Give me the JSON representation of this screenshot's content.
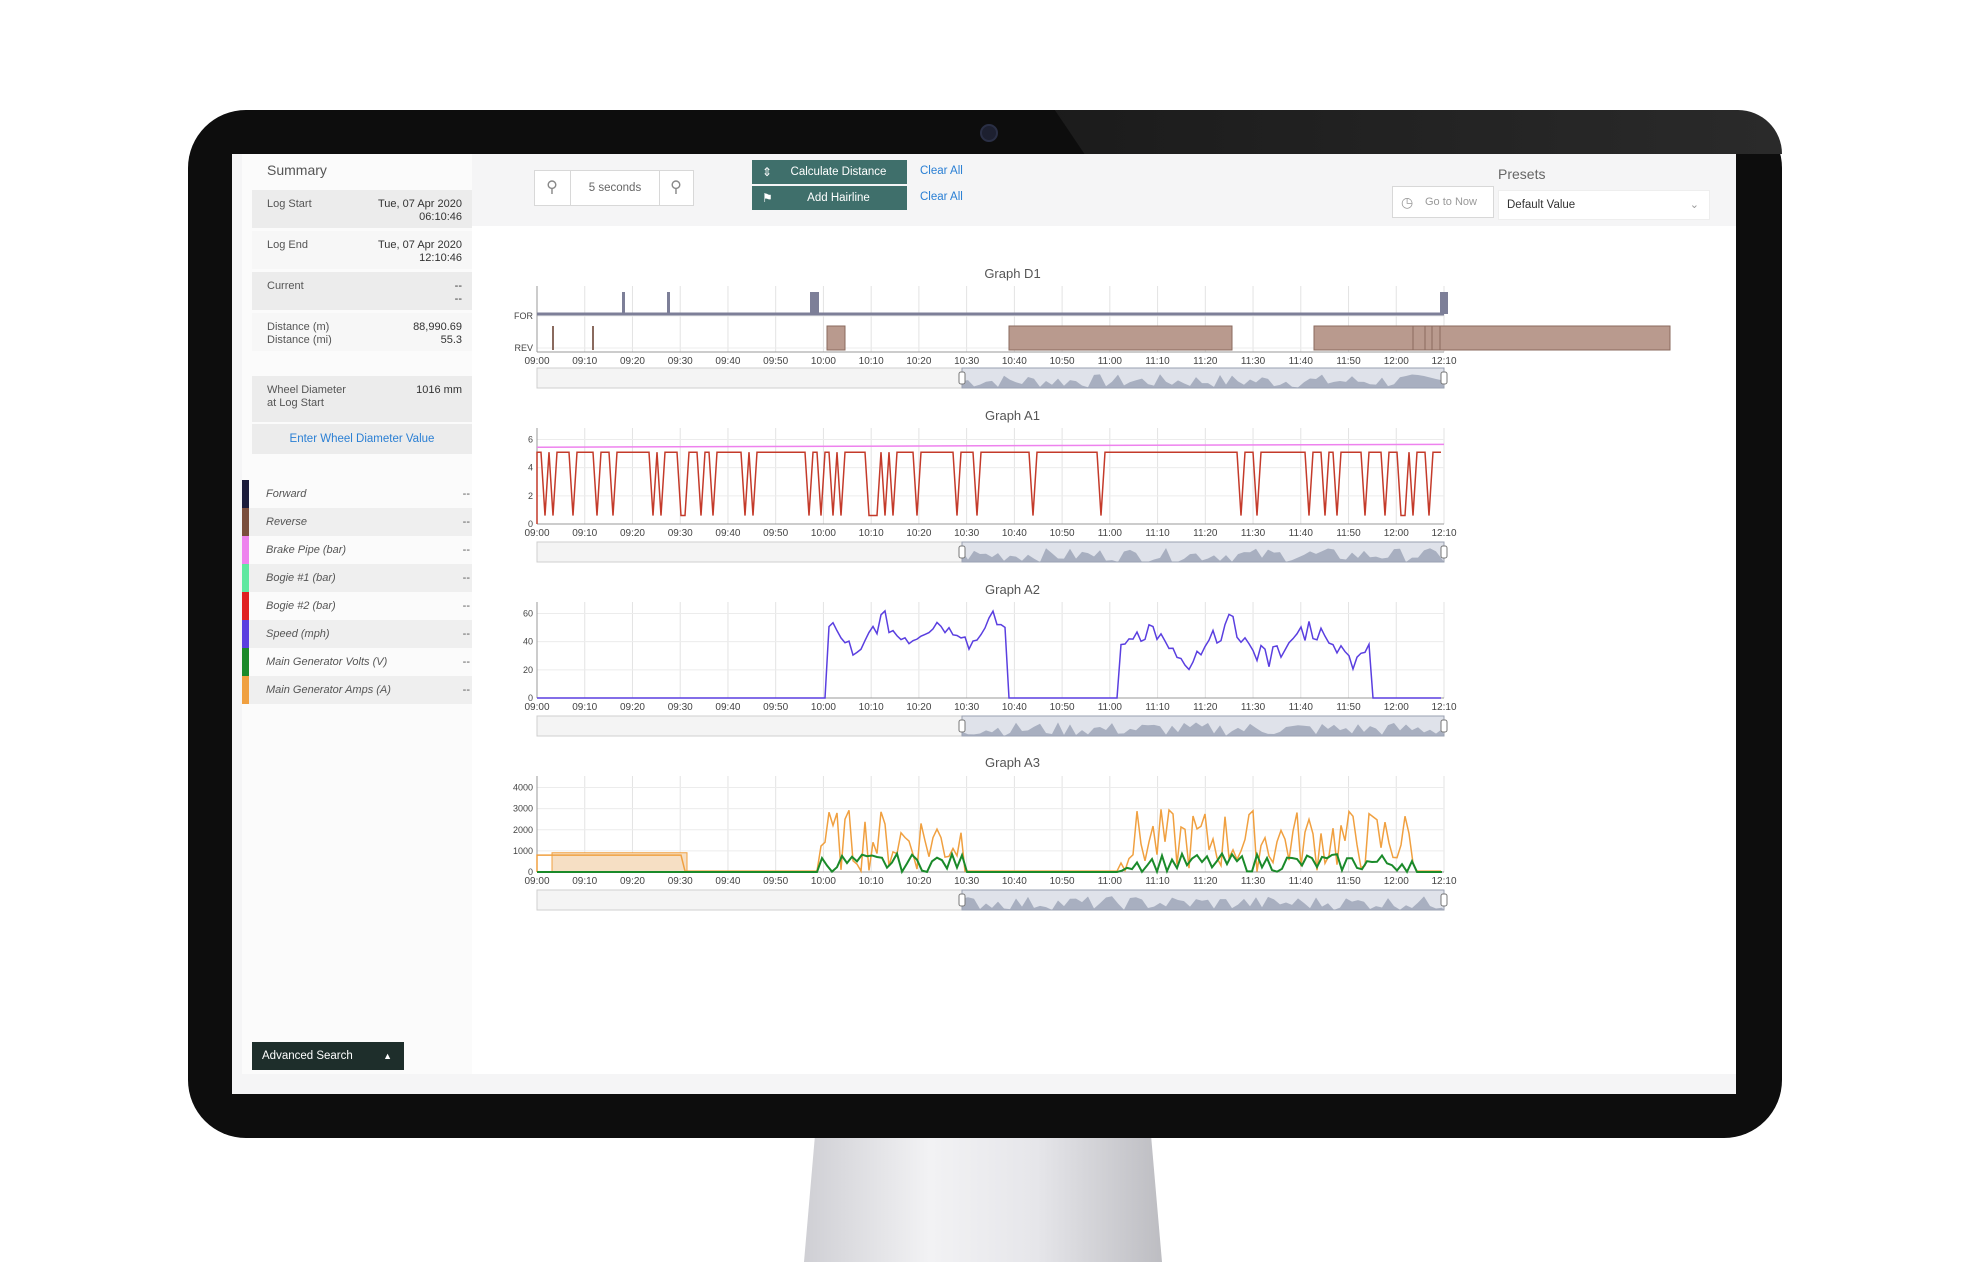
{
  "summary": {
    "title": "Summary",
    "rows": [
      {
        "key": "Log Start",
        "value_line1": "Tue, 07 Apr 2020",
        "value_line2": "06:10:46"
      },
      {
        "key": "Log End",
        "value_line1": "Tue, 07 Apr 2020",
        "value_line2": "12:10:46"
      },
      {
        "key": "Current",
        "value_line1": "--",
        "value_line2": "--"
      },
      {
        "key": "Distance (m)",
        "key_line2": "Distance (mi)",
        "value_line1": "88,990.69",
        "value_line2": "55.3"
      },
      {
        "key": "Wheel Diameter",
        "key_line2": "at Log Start",
        "value_line1": "1016 mm"
      }
    ],
    "wheel_link": "Enter Wheel Diameter Value"
  },
  "legend": [
    {
      "label": "Forward",
      "value": "--",
      "color": "#1c1c3a"
    },
    {
      "label": "Reverse",
      "value": "--",
      "color": "#7b4e3c"
    },
    {
      "label": "Brake Pipe (bar)",
      "value": "--",
      "color": "#ee82ee"
    },
    {
      "label": "Bogie #1 (bar)",
      "value": "--",
      "color": "#5ee8a0"
    },
    {
      "label": "Bogie #2 (bar)",
      "value": "--",
      "color": "#e02020"
    },
    {
      "label": "Speed (mph)",
      "value": "--",
      "color": "#5a3fe0"
    },
    {
      "label": "Main Generator Volts (V)",
      "value": "--",
      "color": "#1a8a2a"
    },
    {
      "label": "Main Generator Amps (A)",
      "value": "--",
      "color": "#f0a040"
    }
  ],
  "advanced_search": "Advanced Search",
  "toolbar": {
    "zoom_value": "5 seconds",
    "calc_distance": "Calculate Distance",
    "add_hairline": "Add Hairline",
    "clear_all_1": "Clear All",
    "clear_all_2": "Clear All",
    "go_to_now": "Go to Now",
    "presets_label": "Presets",
    "preset_value": "Default Value"
  },
  "time_ticks": [
    "09:00",
    "09:10",
    "09:20",
    "09:30",
    "09:40",
    "09:50",
    "10:00",
    "10:10",
    "10:20",
    "10:30",
    "10:40",
    "10:50",
    "11:00",
    "11:10",
    "11:20",
    "11:30",
    "11:40",
    "11:50",
    "12:00",
    "12:10"
  ],
  "graphs": [
    {
      "title": "Graph D1",
      "y_ticks": [
        "FOR",
        "REV"
      ]
    },
    {
      "title": "Graph A1",
      "y_ticks": [
        "6",
        "4",
        "2",
        "0"
      ],
      "ylim": [
        0,
        6
      ]
    },
    {
      "title": "Graph A2",
      "y_ticks": [
        "60",
        "40",
        "20",
        "0"
      ],
      "ylim": [
        0,
        60
      ]
    },
    {
      "title": "Graph A3",
      "y_ticks": [
        "4000",
        "3000",
        "2000",
        "1000",
        "0"
      ],
      "ylim": [
        0,
        4000
      ]
    }
  ],
  "colors": {
    "accent_teal": "#3f6f6b",
    "link_blue": "#2a7fd4",
    "series_fill": "#b99a8e"
  }
}
